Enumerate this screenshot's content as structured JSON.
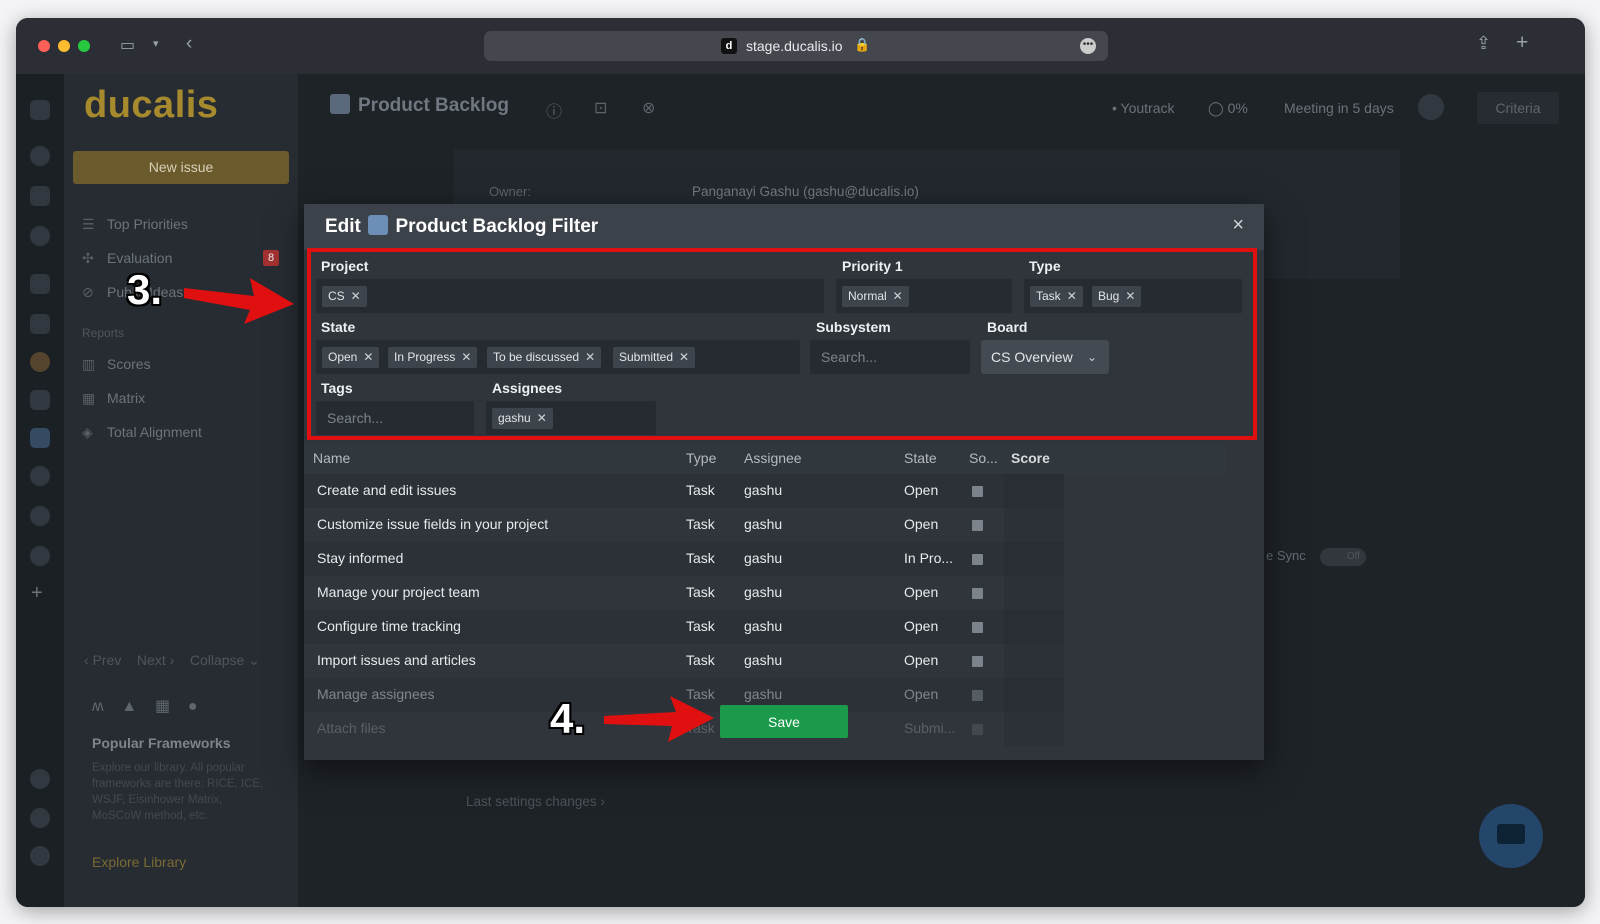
{
  "browser": {
    "url": "stage.ducalis.io",
    "favicon_letter": "d"
  },
  "sidebar": {
    "logo": "ducalis",
    "new_issue": "New issue",
    "items": [
      {
        "label": "Top Priorities",
        "icon": "list-icon"
      },
      {
        "label": "Evaluation",
        "icon": "evaluation-icon",
        "badge": "8"
      },
      {
        "label": "Public Ideas",
        "icon": "public-ideas-icon"
      }
    ],
    "reports_label": "Reports",
    "reports": [
      {
        "label": "Scores",
        "icon": "scores-icon"
      },
      {
        "label": "Matrix",
        "icon": "matrix-icon"
      },
      {
        "label": "Total Alignment",
        "icon": "layers-icon"
      }
    ],
    "pager": {
      "prev": "Prev",
      "next": "Next",
      "collapse": "Collapse"
    },
    "frameworks": {
      "title": "Popular Frameworks",
      "desc": "Explore our library. All popular frameworks are there: RICE, ICE, WSJF, Eisinhower Matrix, MoSCoW method, etc.",
      "link": "Explore Library"
    }
  },
  "header": {
    "title": "Product Backlog",
    "integration": "Youtrack",
    "percent": "0%",
    "meeting": "Meeting in 5 days",
    "criteria": "Criteria"
  },
  "background": {
    "owner_label": "Owner:",
    "owner_value": "Panganayi Gashu (gashu@ducalis.io)",
    "sync_label": "e Sync",
    "sync_state": "Off",
    "last_settings": "Last settings changes"
  },
  "modal": {
    "title_prefix": "Edit",
    "title": "Product Backlog Filter",
    "close": "×",
    "filters": {
      "project": {
        "label": "Project",
        "chips": [
          "CS"
        ]
      },
      "priority": {
        "label": "Priority 1",
        "chips": [
          "Normal"
        ]
      },
      "type": {
        "label": "Type",
        "chips": [
          "Task",
          "Bug"
        ]
      },
      "state": {
        "label": "State",
        "chips": [
          "Open",
          "In Progress",
          "To be discussed",
          "Submitted"
        ]
      },
      "subsystem": {
        "label": "Subsystem",
        "placeholder": "Search..."
      },
      "board": {
        "label": "Board",
        "value": "CS Overview"
      },
      "tags": {
        "label": "Tags",
        "placeholder": "Search..."
      },
      "assignees": {
        "label": "Assignees",
        "chips": [
          "gashu"
        ]
      }
    },
    "table": {
      "headers": [
        "Name",
        "Type",
        "Assignee",
        "State",
        "So...",
        "Score"
      ],
      "rows": [
        {
          "name": "Create and edit issues",
          "type": "Task",
          "assignee": "gashu",
          "state": "Open"
        },
        {
          "name": "Customize issue fields in your project",
          "type": "Task",
          "assignee": "gashu",
          "state": "Open"
        },
        {
          "name": "Stay informed",
          "type": "Task",
          "assignee": "gashu",
          "state": "In Pro..."
        },
        {
          "name": "Manage your project team",
          "type": "Task",
          "assignee": "gashu",
          "state": "Open"
        },
        {
          "name": "Configure time tracking",
          "type": "Task",
          "assignee": "gashu",
          "state": "Open"
        },
        {
          "name": "Import issues and articles",
          "type": "Task",
          "assignee": "gashu",
          "state": "Open"
        },
        {
          "name": "Manage assignees",
          "type": "Task",
          "assignee": "gashu",
          "state": "Open"
        },
        {
          "name": "Attach files",
          "type": "Task",
          "assignee": "",
          "state": "Submi..."
        }
      ]
    },
    "save": "Save"
  },
  "annotations": {
    "step3": "3.",
    "step4": "4."
  },
  "colors": {
    "accent_red": "#e01010",
    "save_green": "#1a9a4a",
    "brand_gold": "#a78a2e"
  }
}
